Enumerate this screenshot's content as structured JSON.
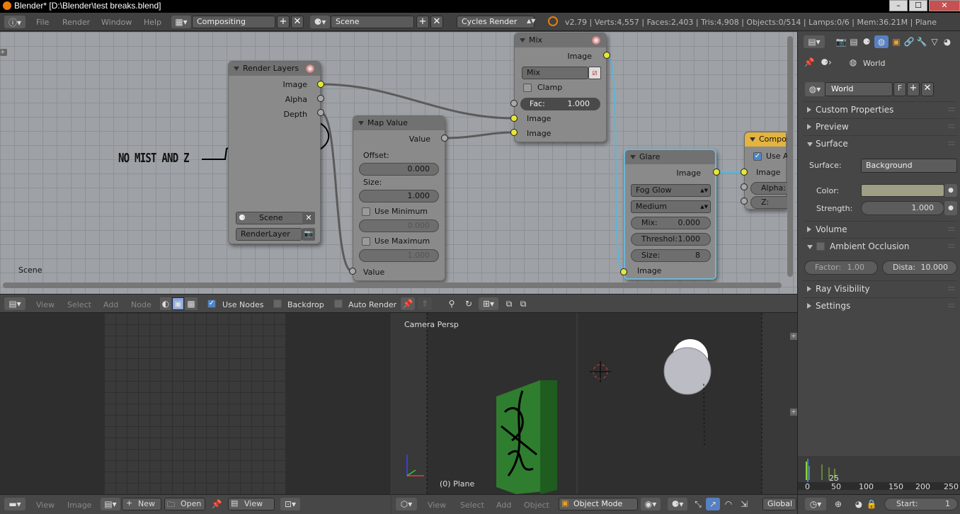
{
  "window": {
    "title": "Blender* [D:\\Blender\\test breaks.blend]"
  },
  "info": {
    "menus": [
      "File",
      "Render",
      "Window",
      "Help"
    ],
    "screen": "Compositing",
    "scene": "Scene",
    "engine": "Cycles Render",
    "stats": "v2.79 | Verts:4,557 | Faces:2,403 | Tris:4,908 | Objects:0/514 | Lamps:0/6 | Mem:36.21M | Plane"
  },
  "canvas": {
    "label": "Scene",
    "annotation": "NO MIST AND Z"
  },
  "render_layers": {
    "title": "Render Layers",
    "outputs": [
      "Image",
      "Alpha",
      "Depth"
    ],
    "scene": "Scene",
    "layer": "RenderLayer"
  },
  "map_value": {
    "title": "Map Value",
    "output": "Value",
    "offset_label": "Offset:",
    "offset": "0.000",
    "size_label": "Size:",
    "size": "1.000",
    "use_min": "Use Minimum",
    "min": "0.000",
    "use_max": "Use Maximum",
    "max": "1.000",
    "input": "Value"
  },
  "mix": {
    "title": "Mix",
    "output": "Image",
    "blend": "Mix",
    "clamp": "Clamp",
    "fac_label": "Fac:",
    "fac": "1.000",
    "in1": "Image",
    "in2": "Image"
  },
  "glare": {
    "title": "Glare",
    "output": "Image",
    "type": "Fog Glow",
    "quality": "Medium",
    "mix_label": "Mix:",
    "mix": "0.000",
    "thresh_label": "Threshol:",
    "thresh": "1.000",
    "size_label": "Size:",
    "size": "8",
    "input": "Image"
  },
  "composite": {
    "title": "Compos",
    "use_alpha": "Use A",
    "inputs": [
      "Image",
      "Alpha:",
      "Z:"
    ]
  },
  "node_header": {
    "menus": [
      "View",
      "Select",
      "Add",
      "Node"
    ],
    "use_nodes": "Use Nodes",
    "backdrop": "Backdrop",
    "auto_render": "Auto Render"
  },
  "viewport": {
    "label": "Camera Persp",
    "object": "(0) Plane"
  },
  "image_header": {
    "menus": [
      "View",
      "Image"
    ],
    "new": "New",
    "open": "Open",
    "view": "View"
  },
  "view3d_header": {
    "menus": [
      "View",
      "Select",
      "Add",
      "Object"
    ],
    "mode": "Object Mode",
    "orientation": "Global"
  },
  "props": {
    "context": "World",
    "world": "World",
    "fake": "F",
    "panels": {
      "custom": "Custom Properties",
      "preview": "Preview",
      "surface": "Surface",
      "volume": "Volume",
      "ao": "Ambient Occlusion",
      "ray": "Ray Visibility",
      "settings": "Settings"
    },
    "surface_label": "Surface:",
    "surface": "Background",
    "color_label": "Color:",
    "color": "#9e9f85",
    "strength_label": "Strength:",
    "strength": "1.000",
    "factor": "Factor:",
    "factor_val": "1.00",
    "dist": "Dista:",
    "dist_val": "10.000"
  },
  "timeline": {
    "frame": "25",
    "ticks": [
      "0",
      "50",
      "100",
      "150",
      "200",
      "250"
    ],
    "start": "Start:",
    "start_val": "1"
  }
}
